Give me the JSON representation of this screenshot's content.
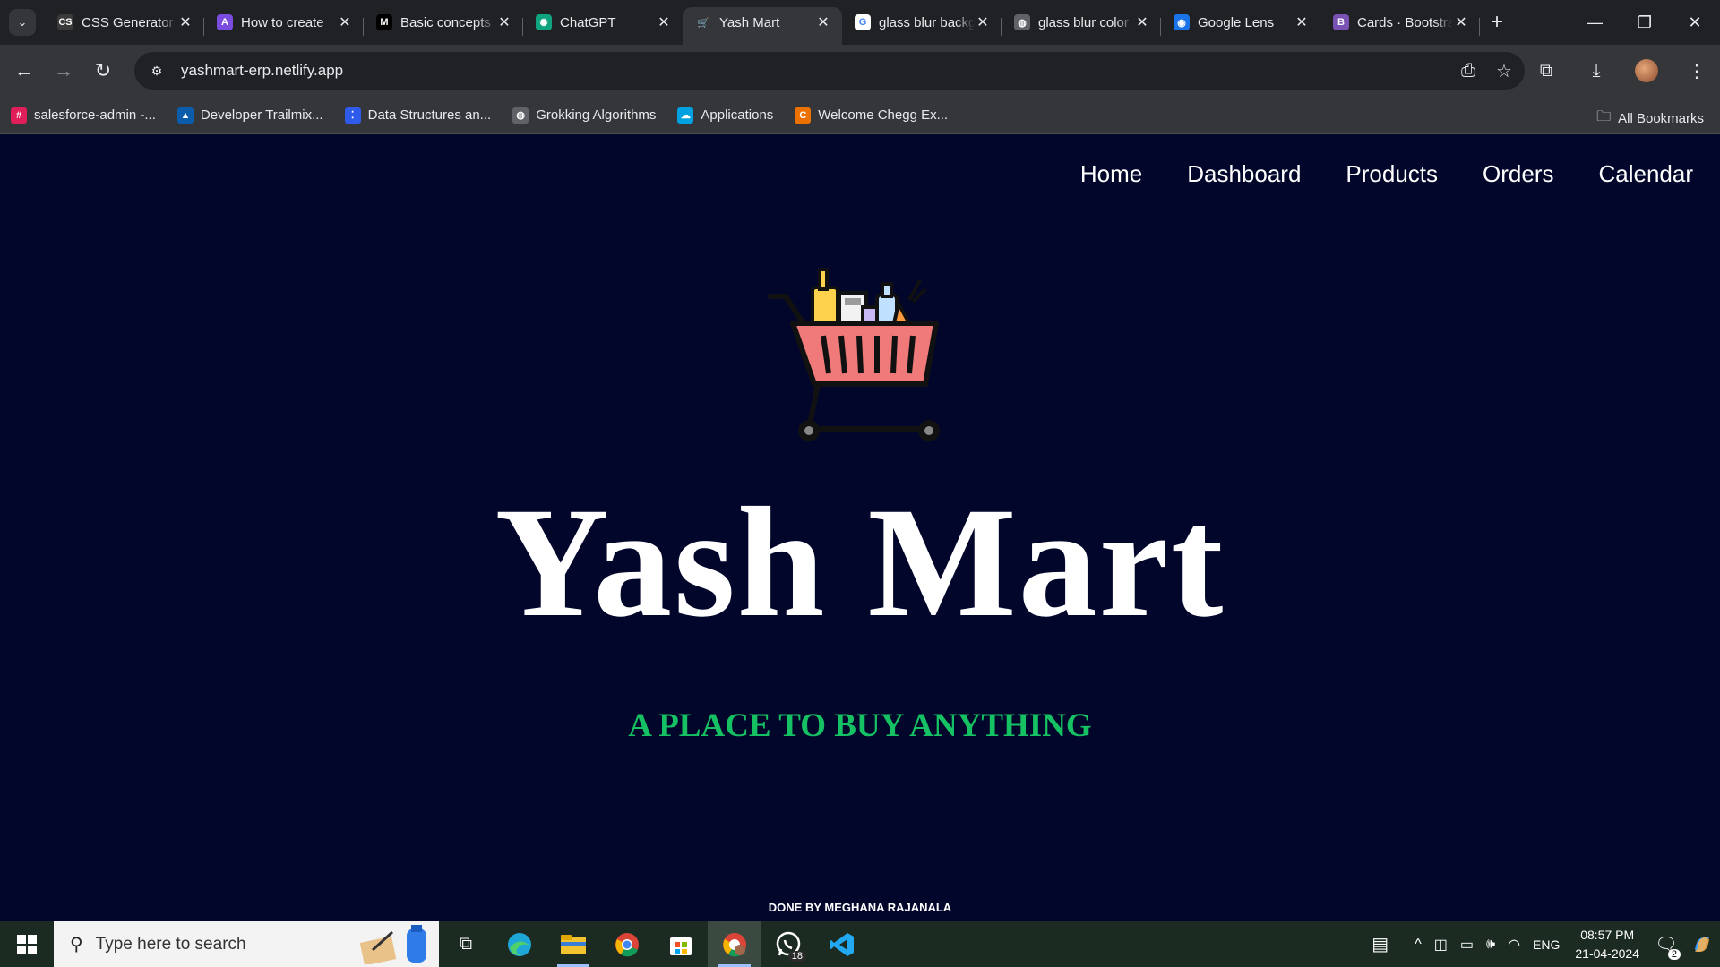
{
  "browser": {
    "tabs": [
      {
        "title": "CSS Generator",
        "favicon": "css-generator-icon",
        "fav_text": "CS",
        "fav_color": "#3a3a3a"
      },
      {
        "title": "How to create",
        "favicon": "astro-icon",
        "fav_text": "A",
        "fav_color": "#7b4ce0"
      },
      {
        "title": "Basic concepts",
        "favicon": "medium-icon",
        "fav_text": "M",
        "fav_color": "#000000"
      },
      {
        "title": "ChatGPT",
        "favicon": "chatgpt-icon",
        "fav_text": "✺",
        "fav_color": "#10a37f"
      },
      {
        "title": "Yash Mart",
        "favicon": "cart-icon",
        "fav_text": "🛒",
        "fav_color": "#35363a",
        "active": true
      },
      {
        "title": "glass blur background",
        "favicon": "google-icon",
        "fav_text": "G",
        "fav_color": "#ffffff"
      },
      {
        "title": "glass blur color",
        "favicon": "globe-icon",
        "fav_text": "◍",
        "fav_color": "#5f6368"
      },
      {
        "title": "Google Lens",
        "favicon": "google-lens-icon",
        "fav_text": "◉",
        "fav_color": "#1a73e8"
      },
      {
        "title": "Cards · Bootstrap",
        "favicon": "bootstrap-icon",
        "fav_text": "B",
        "fav_color": "#7952b3"
      }
    ],
    "url": "yashmart-erp.netlify.app",
    "bookmarks": [
      {
        "label": "salesforce-admin -...",
        "icon": "slack-icon",
        "color": "#e01e5a",
        "glyph": "#"
      },
      {
        "label": "Developer Trailmix...",
        "icon": "trailhead-icon",
        "color": "#0b5cab",
        "glyph": "▲"
      },
      {
        "label": "Data Structures an...",
        "icon": "dots-icon",
        "color": "#2f5bea",
        "glyph": "⁚"
      },
      {
        "label": "Grokking Algorithms",
        "icon": "globe-icon",
        "color": "#5f6368",
        "glyph": "◍"
      },
      {
        "label": "Applications",
        "icon": "salesforce-cloud-icon",
        "color": "#00a1e0",
        "glyph": "☁"
      },
      {
        "label": "Welcome Chegg Ex...",
        "icon": "chegg-icon",
        "color": "#eb7100",
        "glyph": "C"
      }
    ],
    "all_bookmarks": "All Bookmarks"
  },
  "site": {
    "nav": [
      "Home",
      "Dashboard",
      "Products",
      "Orders",
      "Calendar"
    ],
    "title": "Yash Mart",
    "tagline": "A PLACE TO BUY ANYTHING",
    "footer": "DONE BY MEGHANA RAJANALA",
    "colors": {
      "background": "#02062b",
      "tagline": "#15c162",
      "title": "#ffffff"
    }
  },
  "taskbar": {
    "search_placeholder": "Type here to search",
    "whatsapp_badge": "18",
    "language": "ENG",
    "time": "08:57 PM",
    "date": "21-04-2024",
    "notifications": "2"
  }
}
